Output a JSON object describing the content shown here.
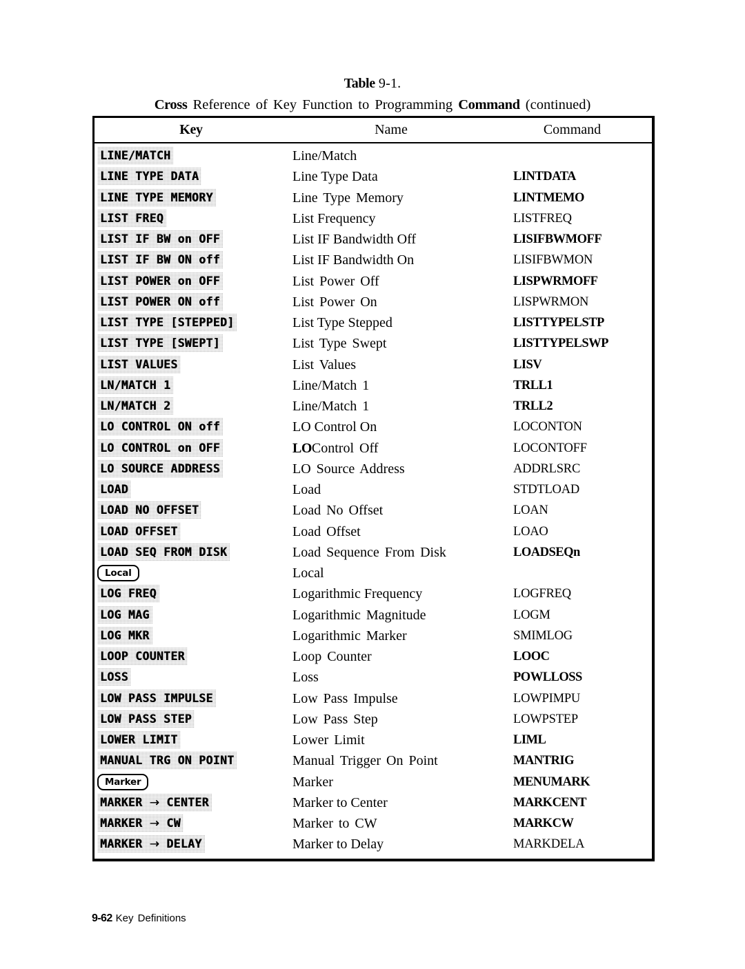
{
  "title": {
    "line1_bold": "Table",
    "line1_rest": " 9-1.",
    "line2_seg1_bold": "Cross",
    "line2_seg2": " Reference of Key Function to Programming ",
    "line2_seg3_bold": "Command",
    "line2_seg4": " (continued)"
  },
  "table": {
    "headers": {
      "key": "Key",
      "name": "Name",
      "command": "Command"
    },
    "rows": [
      {
        "key": "LINE/MATCH",
        "key_type": "softkey",
        "name": "Line/Match",
        "command": "",
        "cmd_bold": false,
        "name_wide": false
      },
      {
        "key": "LINE TYPE DATA",
        "key_type": "softkey",
        "name": "Line Type Data",
        "command": "LINTDATA",
        "cmd_bold": true,
        "name_wide": false
      },
      {
        "key": "LINE TYPE MEMORY",
        "key_type": "softkey",
        "name": "Line Type Memory",
        "command": "LINTMEMO",
        "cmd_bold": true,
        "name_wide": true
      },
      {
        "key": "LIST FREQ",
        "key_type": "softkey",
        "name": "List Frequency",
        "command": "LISTFREQ",
        "cmd_bold": false,
        "name_wide": false
      },
      {
        "key": "LIST IF BW on OFF",
        "key_type": "softkey",
        "name": "List IF Bandwidth Off",
        "command": "LISIFBWMOFF",
        "cmd_bold": true,
        "name_wide": false
      },
      {
        "key": "LIST IF BW ON off",
        "key_type": "softkey",
        "name": "List IF Bandwidth On",
        "command": "LISIFBWMON",
        "cmd_bold": false,
        "name_wide": false
      },
      {
        "key": "LIST POWER on OFF",
        "key_type": "softkey",
        "name": "List Power Off",
        "command": "LISPWRMOFF",
        "cmd_bold": true,
        "name_wide": true
      },
      {
        "key": "LIST POWER ON off",
        "key_type": "softkey",
        "name": "List Power On",
        "command": "LISPWRMON",
        "cmd_bold": false,
        "name_wide": true
      },
      {
        "key": "LIST TYPE [STEPPED]",
        "key_type": "softkey",
        "name": "List Type Stepped",
        "command": "LISTTYPELSTP",
        "cmd_bold": true,
        "name_wide": false
      },
      {
        "key": "LIST TYPE [SWEPT]",
        "key_type": "softkey",
        "name": "List Type Swept",
        "command": "LISTTYPELSWP",
        "cmd_bold": true,
        "name_wide": true
      },
      {
        "key": "LIST VALUES",
        "key_type": "softkey",
        "name": "List Values",
        "command": "LISV",
        "cmd_bold": true,
        "name_wide": true
      },
      {
        "key": "LN/MATCH 1",
        "key_type": "softkey",
        "name": "Line/Match 1",
        "command": "TRLL1",
        "cmd_bold": true,
        "name_wide": true
      },
      {
        "key": "LN/MATCH 2",
        "key_type": "softkey",
        "name": "Line/Match 1",
        "command": "TRLL2",
        "cmd_bold": true,
        "name_wide": true
      },
      {
        "key": "LO CONTROL ON off",
        "key_type": "softkey",
        "name": "LO Control On",
        "command": "LOCONTON",
        "cmd_bold": false,
        "name_wide": false
      },
      {
        "key": "LO CONTROL on OFF",
        "key_type": "softkey",
        "name": "LO Control Off",
        "command": "LOCONTOFF",
        "cmd_bold": false,
        "name_wide": true,
        "name_lead_bold": "LO"
      },
      {
        "key": "LO SOURCE ADDRESS",
        "key_type": "softkey",
        "name": "LO Source Address",
        "command": "ADDRLSRC",
        "cmd_bold": false,
        "name_wide": true
      },
      {
        "key": "LOAD",
        "key_type": "softkey",
        "name": "Load",
        "command": "STDTLOAD",
        "cmd_bold": false,
        "name_wide": false
      },
      {
        "key": "LOAD NO OFFSET",
        "key_type": "softkey",
        "name": "Load No Offset",
        "command": "LOAN",
        "cmd_bold": false,
        "name_wide": true
      },
      {
        "key": "LOAD OFFSET",
        "key_type": "softkey",
        "name": "Load Offset",
        "command": "LOAO",
        "cmd_bold": false,
        "name_wide": true
      },
      {
        "key": "LOAD SEQ FROM DISK",
        "key_type": "softkey",
        "name": "Load Sequence From Disk",
        "command": "LOADSEQn",
        "cmd_bold": true,
        "name_wide": true
      },
      {
        "key": "Local",
        "key_type": "hardkey",
        "name": "Local",
        "command": "",
        "cmd_bold": false,
        "name_wide": false
      },
      {
        "key": "LOG FREQ",
        "key_type": "softkey",
        "name": "Logarithmic Frequency",
        "command": "LOGFREQ",
        "cmd_bold": false,
        "name_wide": false
      },
      {
        "key": "LOG MAG",
        "key_type": "softkey",
        "name": "Logarithmic Magnitude",
        "command": "LOGM",
        "cmd_bold": false,
        "name_wide": true
      },
      {
        "key": "LOG MKR",
        "key_type": "softkey",
        "name": "Logarithmic Marker",
        "command": "SMIMLOG",
        "cmd_bold": false,
        "name_wide": true
      },
      {
        "key": "LOOP COUNTER",
        "key_type": "softkey",
        "name": "Loop Counter",
        "command": "LOOC",
        "cmd_bold": true,
        "name_wide": true
      },
      {
        "key": "LOSS",
        "key_type": "softkey",
        "name": "Loss",
        "command": "POWLLOSS",
        "cmd_bold": true,
        "name_wide": false
      },
      {
        "key": "LOW PASS IMPULSE",
        "key_type": "softkey",
        "name": "Low Pass Impulse",
        "command": "LOWPIMPU",
        "cmd_bold": false,
        "name_wide": true
      },
      {
        "key": "LOW PASS STEP",
        "key_type": "softkey",
        "name": "Low Pass Step",
        "command": "LOWPSTEP",
        "cmd_bold": false,
        "name_wide": true
      },
      {
        "key": "LOWER LIMIT",
        "key_type": "softkey",
        "name": "Lower Limit",
        "command": "LIML",
        "cmd_bold": true,
        "name_wide": true
      },
      {
        "key": "MANUAL TRG ON POINT",
        "key_type": "softkey",
        "name": "Manual Trigger On Point",
        "command": "MANTRIG",
        "cmd_bold": true,
        "name_wide": true
      },
      {
        "key": "Marker",
        "key_type": "hardkey",
        "name": "Marker",
        "command": "MENUMARK",
        "cmd_bold": true,
        "name_wide": false
      },
      {
        "key": "MARKER → CENTER",
        "key_type": "softkey",
        "name": "Marker to Center",
        "command": "MARKCENT",
        "cmd_bold": true,
        "name_wide": false
      },
      {
        "key": "MARKER → CW",
        "key_type": "softkey",
        "name": "Marker to CW",
        "command": "MARKCW",
        "cmd_bold": true,
        "name_wide": true
      },
      {
        "key": "MARKER → DELAY",
        "key_type": "softkey",
        "name": "Marker to Delay",
        "command": "MARKDELA",
        "cmd_bold": false,
        "name_wide": false
      }
    ]
  },
  "footer": {
    "page_number": "9-62",
    "section_label": "Key Definitions"
  }
}
